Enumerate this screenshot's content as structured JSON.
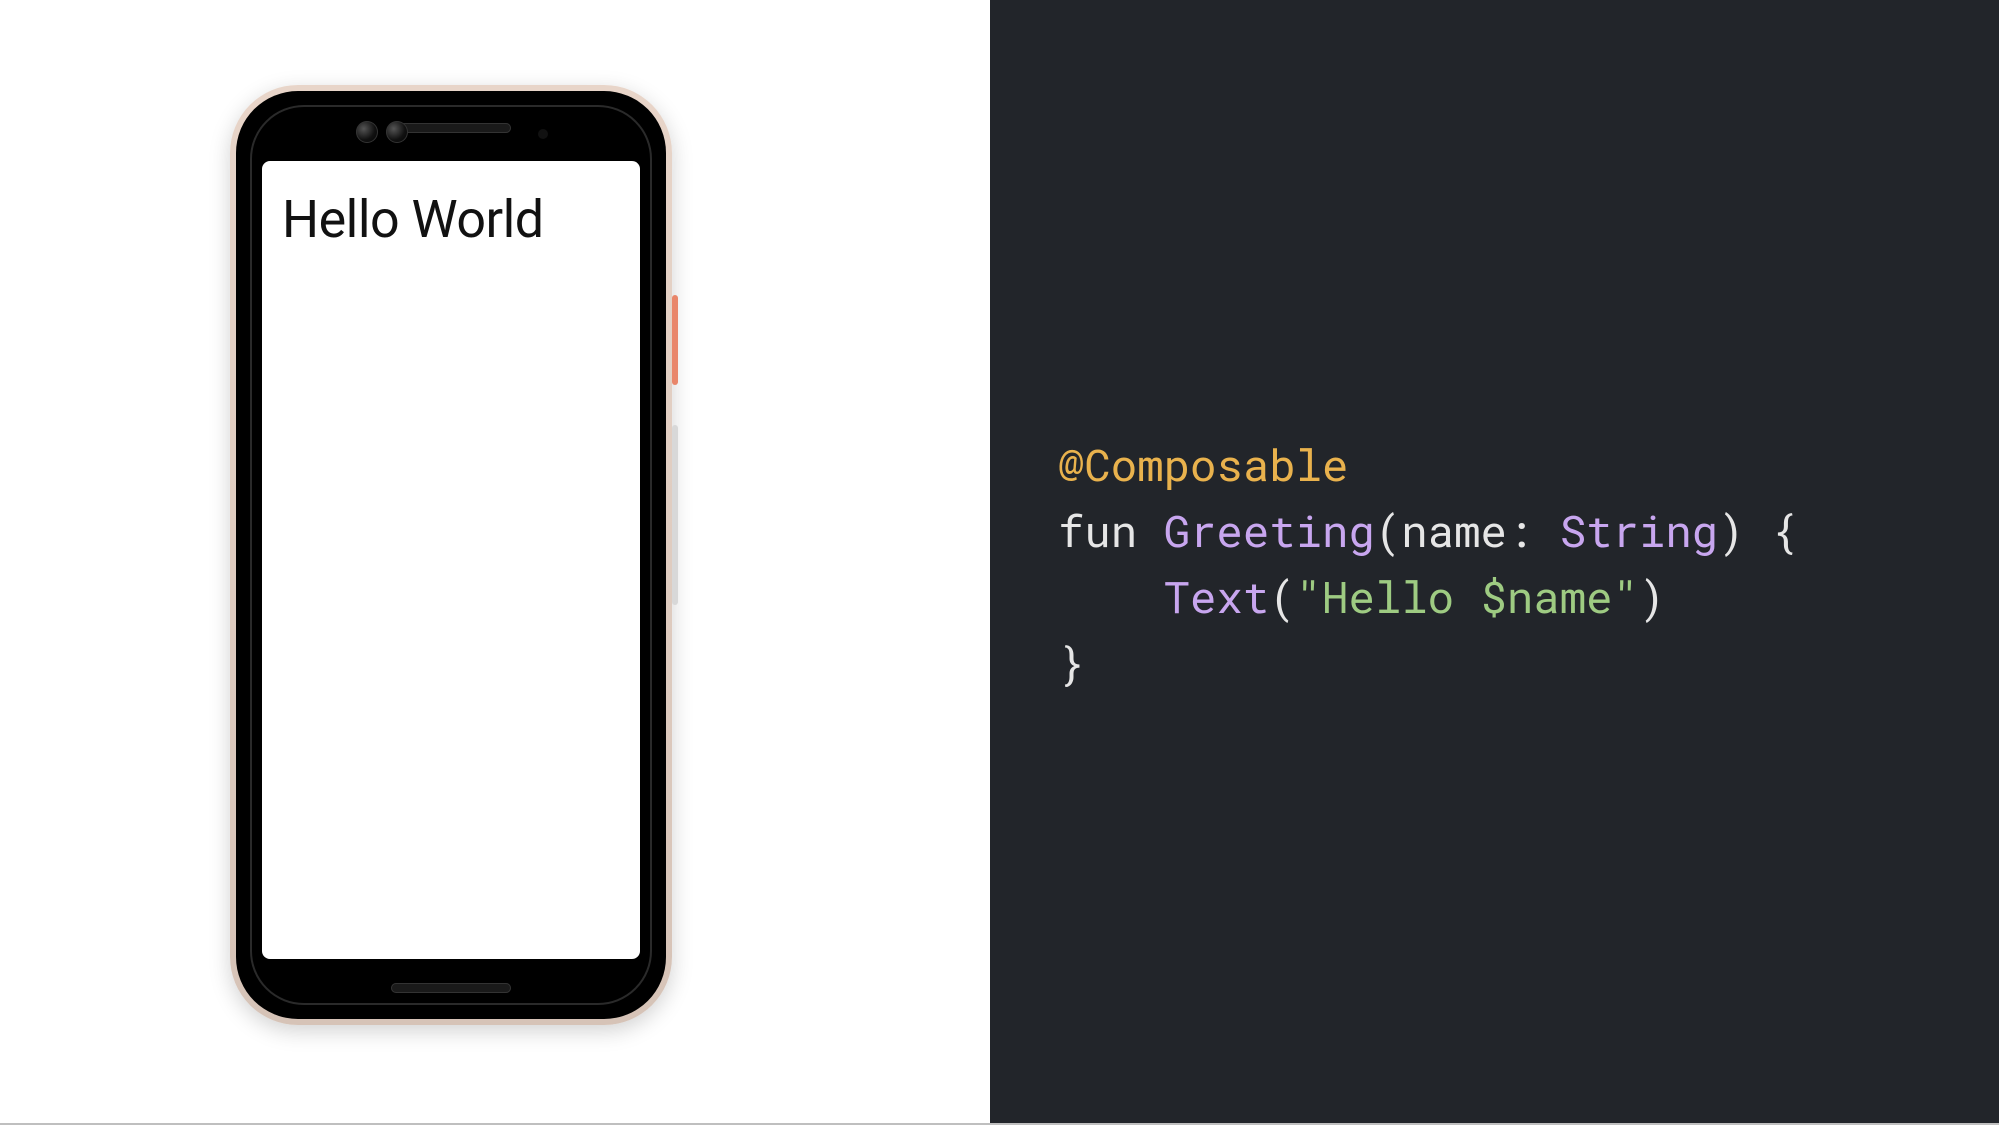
{
  "phone": {
    "screen_text": "Hello World"
  },
  "code": {
    "annotation": "@Composable",
    "kw_fun": "fun",
    "func_name": "Greeting",
    "open_paren": "(",
    "param_name": "name",
    "colon_space": ": ",
    "param_type": "String",
    "close_paren_brace": ") {",
    "indent": "    ",
    "call_name": "Text",
    "call_open": "(",
    "string_lit": "\"Hello $name\"",
    "call_close": ")",
    "close_brace": "}"
  }
}
